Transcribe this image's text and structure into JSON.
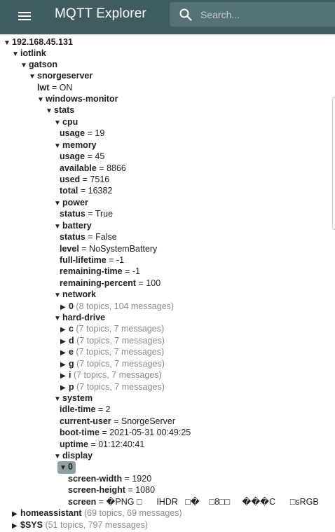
{
  "app": {
    "title": "MQTT Explorer"
  },
  "search": {
    "placeholder": "Search..."
  },
  "tree": {
    "root": {
      "label": "192.168.45.131"
    },
    "iotlink": {
      "label": "iotlink"
    },
    "gatson": {
      "label": "gatson"
    },
    "snorgeserver": {
      "label": "snorgeserver"
    },
    "lwt": {
      "label": "lwt",
      "value": " = ON"
    },
    "windows_monitor": {
      "label": "windows-monitor"
    },
    "stats": {
      "label": "stats"
    },
    "cpu": {
      "label": "cpu",
      "usage": {
        "label": "usage",
        "value": " = 19"
      }
    },
    "memory": {
      "label": "memory",
      "usage": {
        "label": "usage",
        "value": " = 45"
      },
      "available": {
        "label": "available",
        "value": " = 8866"
      },
      "used": {
        "label": "used",
        "value": " = 7516"
      },
      "total": {
        "label": "total",
        "value": " = 16382"
      }
    },
    "power": {
      "label": "power",
      "status": {
        "label": "status",
        "value": " = True"
      }
    },
    "battery": {
      "label": "battery",
      "status": {
        "label": "status",
        "value": " = False"
      },
      "level": {
        "label": "level",
        "value": " = NoSystemBattery"
      },
      "full_lifetime": {
        "label": "full-lifetime",
        "value": " = -1"
      },
      "remaining_time": {
        "label": "remaining-time",
        "value": " = -1"
      },
      "remaining_percent": {
        "label": "remaining-percent",
        "value": " = 100"
      }
    },
    "network": {
      "label": "network",
      "n0": {
        "label": "0",
        "meta": " (8 topics, 104 messages)"
      }
    },
    "hard_drive": {
      "label": "hard-drive",
      "c": {
        "label": "c",
        "meta": " (7 topics, 7 messages)"
      },
      "d": {
        "label": "d",
        "meta": " (7 topics, 7 messages)"
      },
      "e": {
        "label": "e",
        "meta": " (7 topics, 7 messages)"
      },
      "g": {
        "label": "g",
        "meta": " (7 topics, 7 messages)"
      },
      "i": {
        "label": "i",
        "meta": " (7 topics, 7 messages)"
      },
      "p": {
        "label": "p",
        "meta": " (7 topics, 7 messages)"
      }
    },
    "system": {
      "label": "system",
      "idle_time": {
        "label": "idle-time",
        "value": " = 2"
      },
      "current_user": {
        "label": "current-user",
        "value": " = SnorgeServer"
      },
      "boot_time": {
        "label": "boot-time",
        "value": " = 2021-05-31 00:49:25"
      },
      "uptime": {
        "label": "uptime",
        "value": " = 01:12:40:41"
      }
    },
    "display": {
      "label": "display",
      "d0": {
        "label": "0"
      },
      "screen_width": {
        "label": "screen-width",
        "value": " = 1920"
      },
      "screen_height": {
        "label": "screen-height",
        "value": " = 1080"
      },
      "screen": {
        "label": "screen",
        "value": " = �PNG □      IHDR   □�    □8□□     ���C      □sRGB"
      }
    },
    "homeassistant": {
      "label": "homeassistant",
      "meta": " (69 topics, 69 messages)"
    },
    "sys": {
      "label": "$SYS",
      "meta": " (51 topics, 797 messages)"
    }
  },
  "glyphs": {
    "expanded": "▼",
    "collapsed": "▶"
  },
  "colors": {
    "appbar": "#3f5d61",
    "search_bg": "#557377",
    "selected": "#8fa1a4",
    "meta_text": "#8a8a8a"
  },
  "icons": {
    "menu": "menu-icon",
    "search": "search-icon"
  }
}
